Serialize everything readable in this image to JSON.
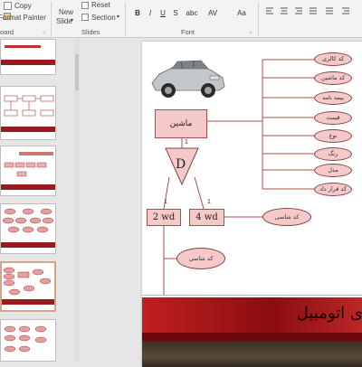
{
  "ribbon": {
    "clipboard": {
      "copy_label": "Copy",
      "format_painter_label": "Format Painter",
      "group_label": "oard"
    },
    "slides": {
      "new_slide_label_1": "New",
      "new_slide_label_2": "Slide",
      "reset_label": "Reset",
      "section_label": "Section",
      "group_label": "Slides"
    },
    "font": {
      "bold": "B",
      "italic": "I",
      "underline": "U",
      "strike": "S",
      "shadow": "abc",
      "spacing": "AV",
      "case": "Aa",
      "group_label": "Font"
    }
  },
  "slide": {
    "entity_main": "ماشین",
    "relation": "D",
    "entity_left": "2 wd",
    "entity_right": "4 wd",
    "card_top": "1",
    "card_left": "1",
    "card_right": "1",
    "attributes": [
      "کد کالری",
      "کد ماشین",
      "بیمه نامه",
      "قیمت",
      "نوع",
      "رنگ",
      "مدل",
      "کد قرار داد"
    ],
    "attr_right": "کد شاسی",
    "attr_bottom": "کد شاسی",
    "footer_title": "ی اتومبیل"
  },
  "colors": {
    "accent_red": "#9b1a1d",
    "entity_fill": "#f5c9c9",
    "line_color": "#b34b4b"
  }
}
